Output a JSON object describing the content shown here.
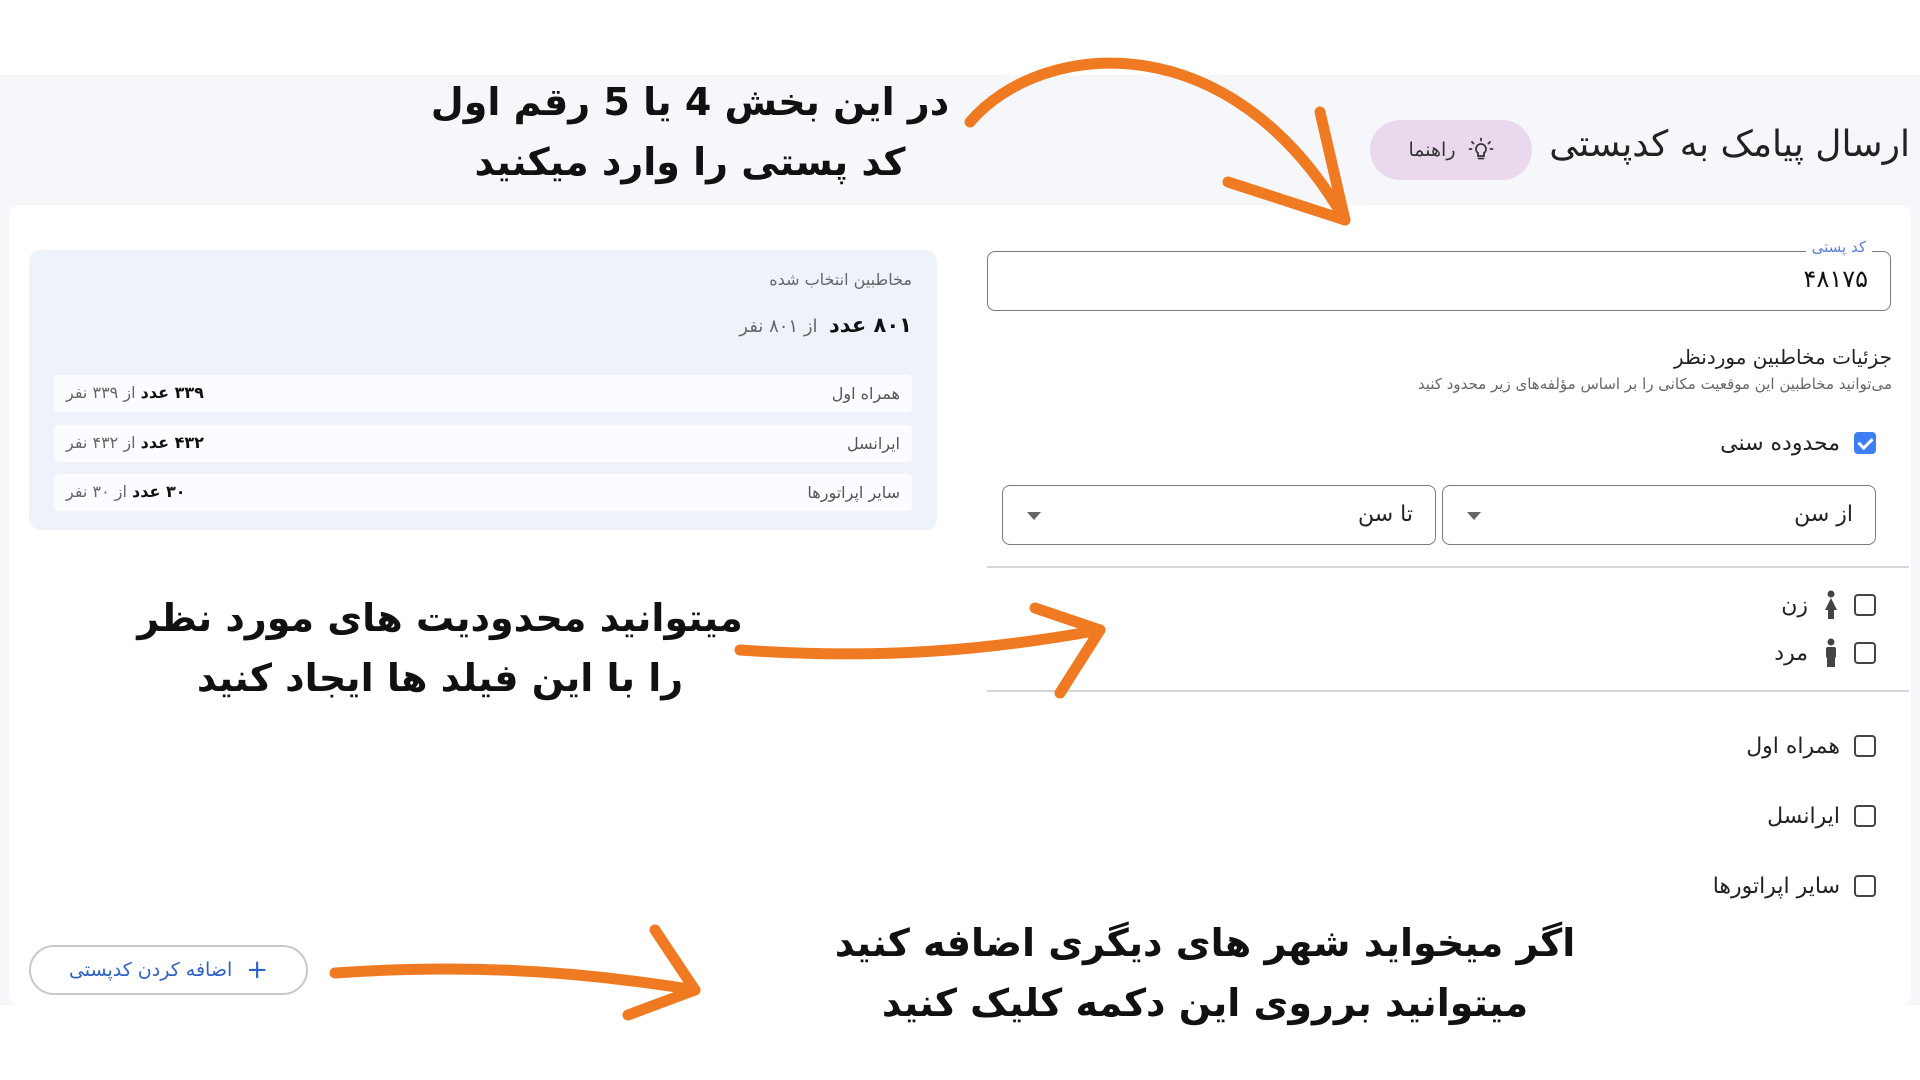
{
  "header": {
    "title": "ارسال پیامک به کدپستی",
    "guide_label": "راهنما"
  },
  "postal_field": {
    "label": "کد پستی",
    "value": "۴۸۱۷۵"
  },
  "details": {
    "title": "جزئیات مخاطبین موردنظر",
    "description": "می‌توانید مخاطبین این موقعیت مکانی را بر اساس مؤلفه‌های زیر محدود کنید"
  },
  "age_range": {
    "label": "محدوده سنی",
    "checked": true,
    "from_label": "از سن",
    "to_label": "تا سن"
  },
  "gender": [
    {
      "label": "زن",
      "icon": "female-icon",
      "checked": false
    },
    {
      "label": "مرد",
      "icon": "male-icon",
      "checked": false
    }
  ],
  "operators": [
    {
      "label": "همراه اول",
      "checked": false
    },
    {
      "label": "ایرانسل",
      "checked": false
    },
    {
      "label": "سایر اپراتورها",
      "checked": false
    }
  ],
  "selected_audience": {
    "title": "مخاطبین انتخاب شده",
    "total_value": "۸۰۱ عدد",
    "total_of": "از ۸۰۱ نفر",
    "rows": [
      {
        "name": "همراه اول",
        "value": "۳۳۹ عدد",
        "of": "از ۳۳۹ نفر"
      },
      {
        "name": "ایرانسل",
        "value": "۴۳۲ عدد",
        "of": "از ۴۳۲ نفر"
      },
      {
        "name": "سایر اپراتورها",
        "value": "۳۰ عدد",
        "of": "از ۳۰ نفر"
      }
    ]
  },
  "add_postal_button": {
    "label": "اضافه کردن کدپستی",
    "icon": "plus-icon"
  },
  "annotations": {
    "top": [
      "در این بخش 4 یا 5 رقم اول",
      "کد پستی را وارد میکنید"
    ],
    "middle": [
      "میتوانید محدودیت های مورد نظر",
      "را با این فیلد ها ایجاد کنید"
    ],
    "bottom": [
      "اگر میخواید شهر های دیگری اضافه کنید",
      "میتوانید برروی این دکمه کلیک کنید"
    ]
  },
  "colors": {
    "accent": "#3d7ef5",
    "guide_button_bg": "#ead9ec",
    "annotation_arrow": "#f07a22",
    "panel_bg": "#eef2fb"
  }
}
